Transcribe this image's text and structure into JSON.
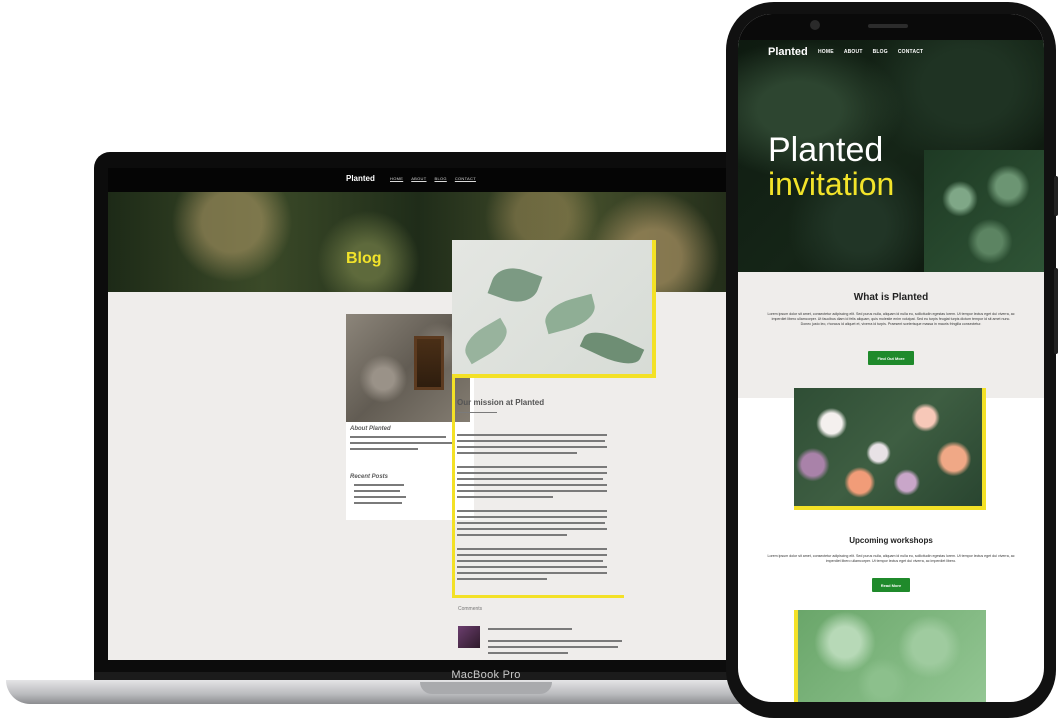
{
  "laptop": {
    "model_label": "MacBook Pro",
    "site": {
      "brand": "Planted",
      "nav": [
        "HOME",
        "ABOUT",
        "BLOG",
        "CONTACT"
      ],
      "hero_title": "Blog",
      "sidebar": {
        "about_heading": "About Planted",
        "recent_posts_heading": "Recent Posts"
      },
      "article_title": "Our mission at Planted",
      "comments_heading": "Comments"
    }
  },
  "phone": {
    "brand": "Planted",
    "nav": [
      "HOME",
      "ABOUT",
      "BLOG",
      "CONTACT"
    ],
    "hero_line1": "Planted",
    "hero_line2": "invitation",
    "section1": {
      "heading": "What is Planted",
      "body": "Lorem ipsum dolor sit amet, consectetur adipiscing elit. Sed purus nulla, aliquam id nulla eu, sollicitudin egestas lorem. Ut tempor lectus eget dui viverra, ac imperdiet libero ullamcorper. Ut faucibus diam id felis aliquam, quis molestie enim volutpat. Sed eu turpis feugiat turpis dictum tempor id sit amet nunc. Donec justo leo, rhoncus id aliquet et, viverra id turpis. Praesent scelerisque massa in mauris fringilla consectetur.",
      "button": "Find Out More"
    },
    "section2": {
      "heading": "Upcoming workshops",
      "body": "Lorem ipsum dolor sit amet, consectetur adipiscing elit. Sed purus nulla, aliquam id nulla eu, sollicitudin egestas lorem. Ut tempor lectus eget dui viverra, ac imperdiet libero ullamcorper. Ut tempor lectus eget dui viverra, ac imperdiet libero.",
      "button": "Read More"
    }
  },
  "colors": {
    "accent_yellow": "#f3e126",
    "button_green": "#1f8a2b",
    "section_bg": "#efedeb"
  }
}
